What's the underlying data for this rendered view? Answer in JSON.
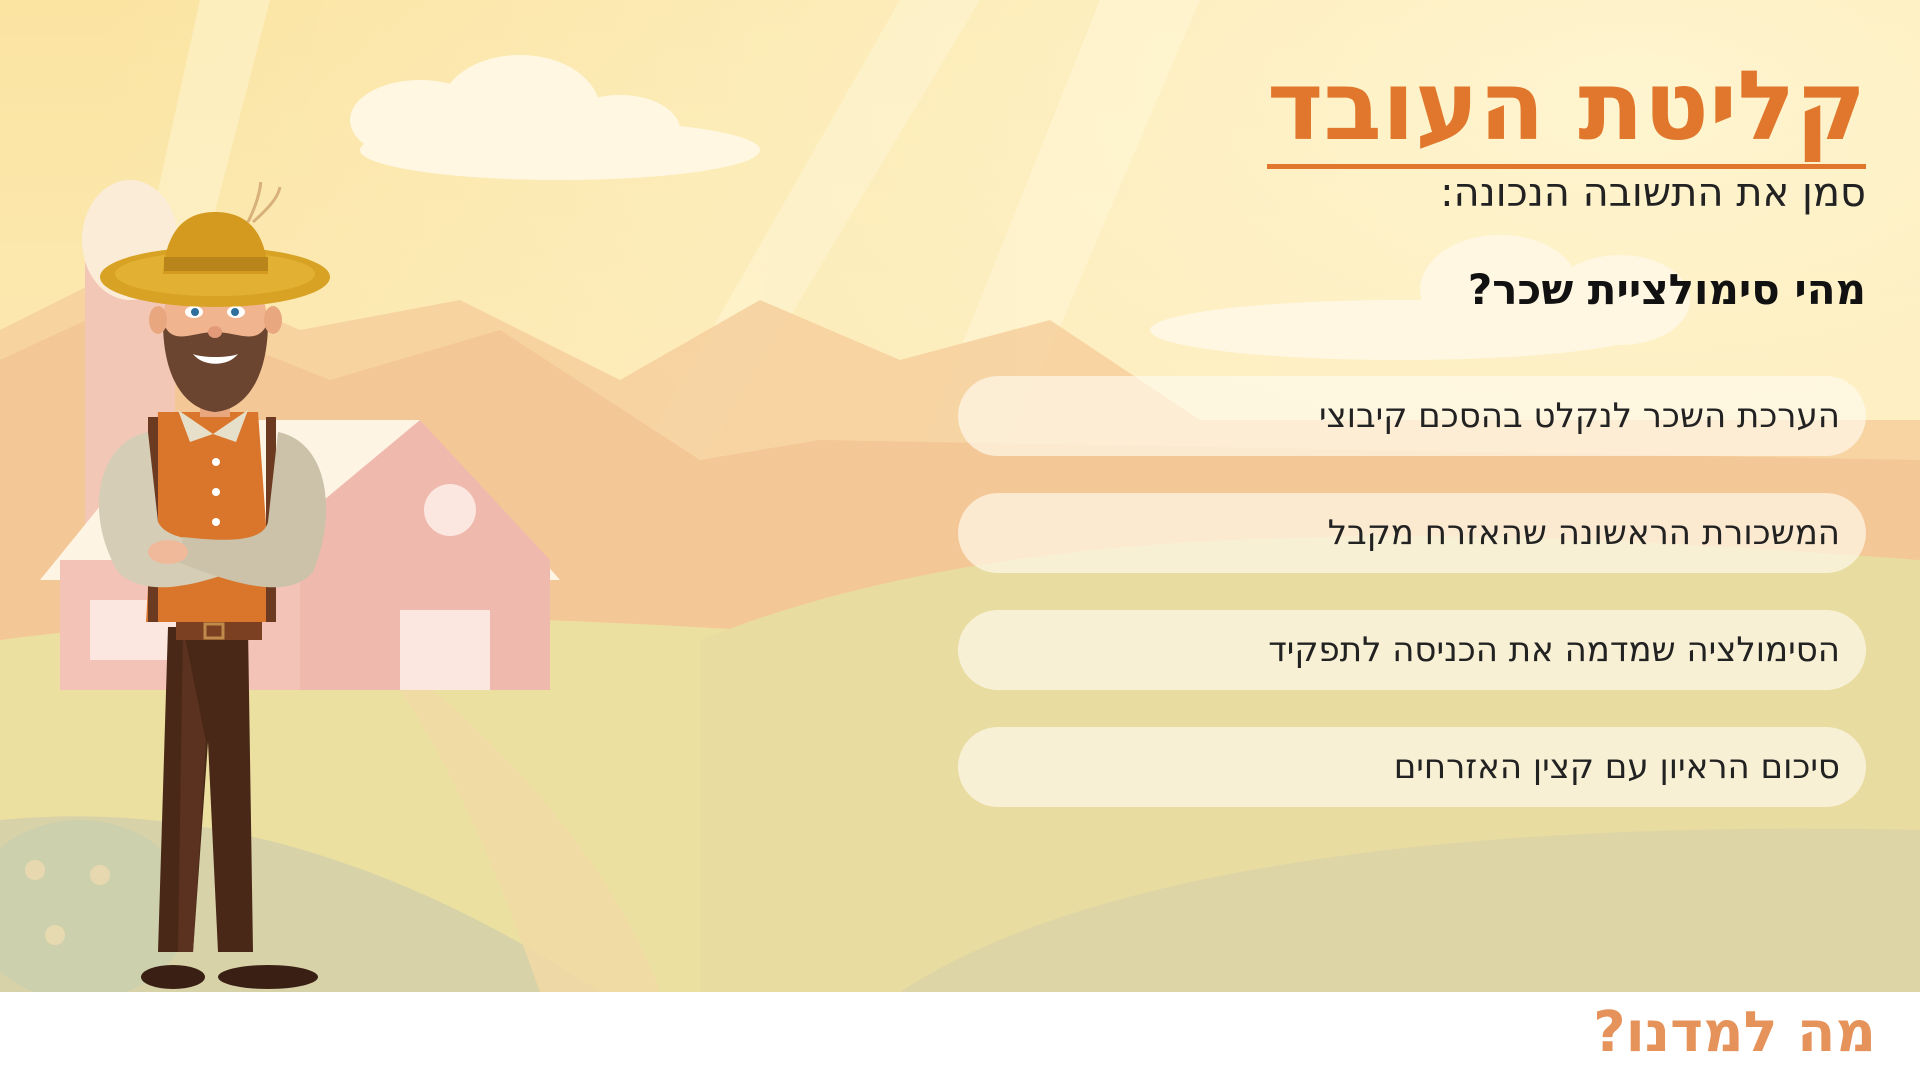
{
  "colors": {
    "accent": "#e0772c",
    "footer_text": "#e5935a",
    "sky": "#fbe6a6",
    "option_bg": "#fff8ec"
  },
  "slide": {
    "title": "קליטת העובד",
    "instruction": "סמן את התשובה הנכונה:",
    "question": "מהי סימולציית שכר?"
  },
  "options": [
    {
      "label": "הערכת השכר לנקלט בהסכם קיבוצי"
    },
    {
      "label": "המשכורת הראשונה שהאזרח מקבל"
    },
    {
      "label": "הסימולציה שמדמה את הכניסה לתפקיד"
    },
    {
      "label": "סיכום הראיון עם קצין האזרחים"
    }
  ],
  "footer": {
    "label": "מה למדנו?"
  },
  "illustration": {
    "character": "farmer-character",
    "background": "farm-background"
  }
}
